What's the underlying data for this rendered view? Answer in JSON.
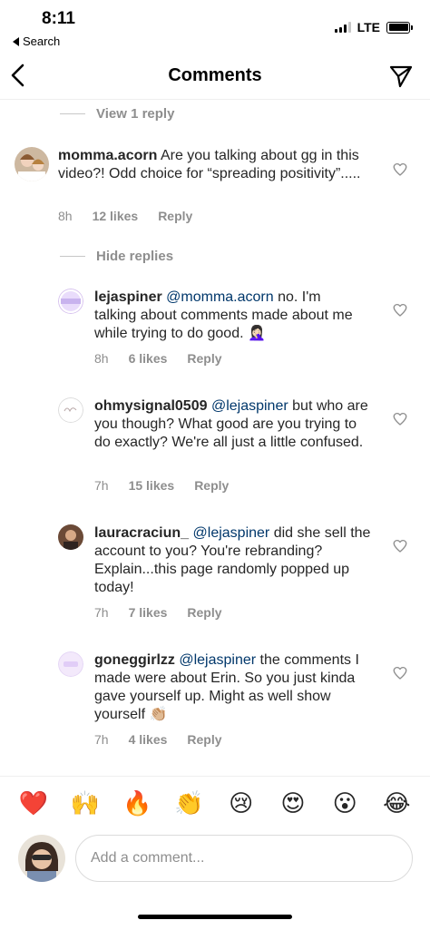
{
  "status_bar": {
    "time": "8:11",
    "back_label": "Search",
    "network": "LTE"
  },
  "nav": {
    "title": "Comments",
    "back_icon": "chevron-left-icon",
    "send_icon": "paper-plane-icon"
  },
  "thread_controls": {
    "view_replies": "View 1 reply",
    "hide_replies": "Hide replies"
  },
  "comments": [
    {
      "username": "momma.acorn",
      "mention": "",
      "text": "Are you talking about gg in this video?! Odd choice for “spreading positivity”.....",
      "time": "8h",
      "likes": "12 likes",
      "reply": "Reply"
    },
    {
      "username": "lejaspiner",
      "mention": "@momma.acorn",
      "text": "no. I'm talking about comments made about me while trying to do good. 🤦🏻‍♀️",
      "time": "8h",
      "likes": "6 likes",
      "reply": "Reply"
    },
    {
      "username": "ohmysignal0509",
      "mention": "@lejaspiner",
      "text": "but who are you though? What good are you trying to do exactly? We're all just a little confused.",
      "time": "7h",
      "likes": "15 likes",
      "reply": "Reply"
    },
    {
      "username": "lauracraciun_",
      "mention": "@lejaspiner",
      "text": "did she sell the account to you? You're rebranding? Explain...this page randomly popped up today!",
      "time": "7h",
      "likes": "7 likes",
      "reply": "Reply"
    },
    {
      "username": "goneggirlzz",
      "mention": "@lejaspiner",
      "text": "the comments I made were about Erin. So you just kinda gave yourself up. Might as well show yourself 👏🏼",
      "time": "7h",
      "likes": "4 likes",
      "reply": "Reply"
    }
  ],
  "avatar_badges": {
    "lejaspiner": "lejaspiner"
  },
  "emoji_bar": [
    "❤️",
    "🙌",
    "🔥",
    "👏",
    "😢",
    "😍",
    "😮",
    "😂"
  ],
  "composer": {
    "placeholder": "Add a comment..."
  },
  "colors": {
    "mention": "#00376b",
    "secondary_text": "#8e8e8e",
    "primary_text": "#262626"
  }
}
